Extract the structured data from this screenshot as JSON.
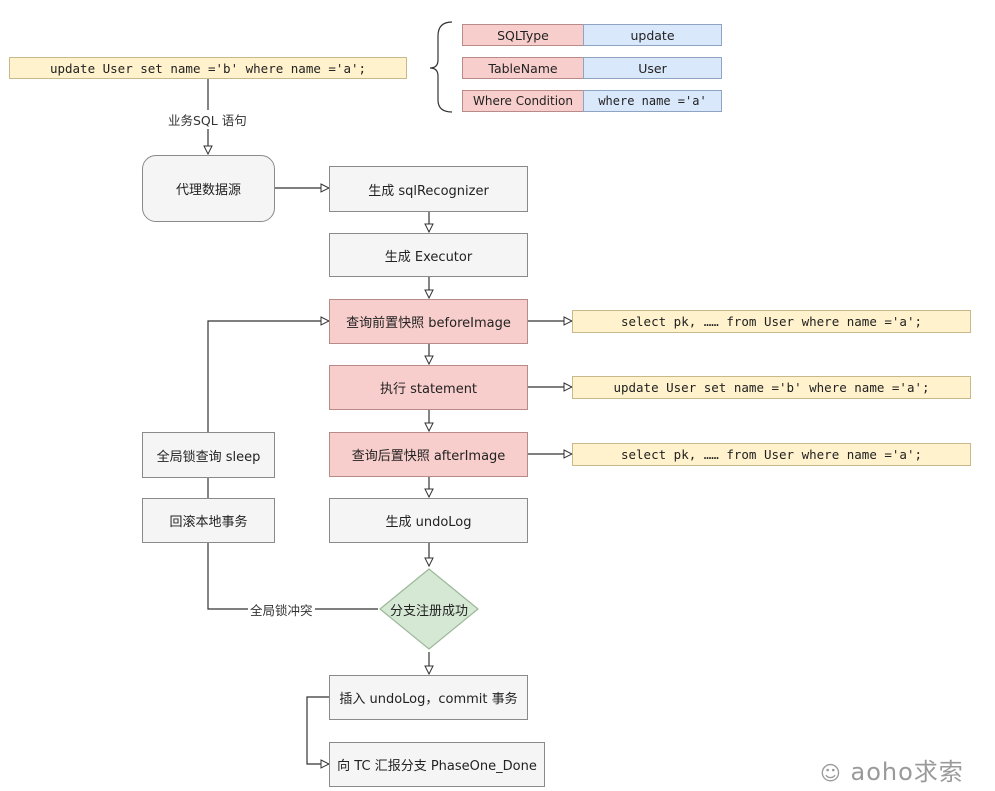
{
  "sql_input": "update User set name ='b' where name ='a';",
  "sql_input_edge_label": "业务SQL 语句",
  "parse_table": [
    {
      "key": "SQLType",
      "value": "update"
    },
    {
      "key": "TableName",
      "value": "User"
    },
    {
      "key": "Where Condition",
      "value": "where name ='a'"
    }
  ],
  "nodes": {
    "proxy_datasource": "代理数据源",
    "gen_recognizer": "生成 sqlRecognizer",
    "gen_executor": "生成 Executor",
    "before_image": "查询前置快照 beforeImage",
    "exec_statement": "执行 statement",
    "after_image": "查询后置快照 afterImage",
    "gen_undolog": "生成 undoLog",
    "branch_register": "分支注册成功",
    "insert_commit": "插入 undoLog，commit 事务",
    "report_tc": "向 TC 汇报分支 PhaseOne_Done",
    "global_lock_sleep": "全局锁查询 sleep",
    "rollback_local": "回滚本地事务"
  },
  "side_sql": {
    "before_image_sql": "select pk, …… from User where name ='a';",
    "statement_sql": "update User set name ='b' where name ='a';",
    "after_image_sql": "select pk, …… from User where name ='a';"
  },
  "edge_labels": {
    "lock_conflict": "全局锁冲突"
  },
  "watermark": "aoho求索",
  "colors": {
    "pink_fill": "#f8cecc",
    "yellow_fill": "#fff2cc",
    "blue_fill": "#dae8fc",
    "green_fill": "#d5e8d4",
    "gray_fill": "#f5f5f5"
  }
}
